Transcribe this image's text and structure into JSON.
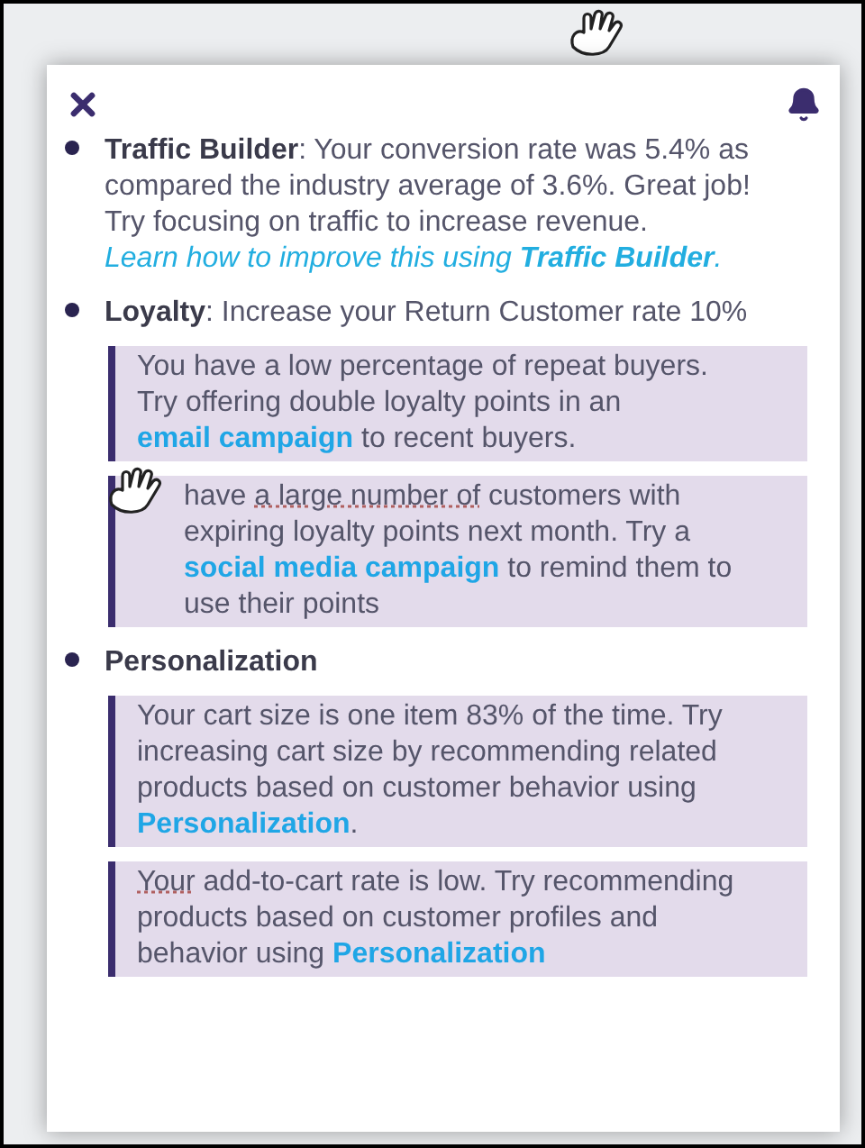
{
  "sections": [
    {
      "parts": [
        {
          "kind": "bold",
          "text": "Traffic Builder"
        },
        {
          "kind": "text",
          "text": ": Your conversion rate was 5.4% as compared the industry average of 3.6%.  Great job!  Try focusing on traffic to increase revenue.  "
        },
        {
          "kind": "emphasis",
          "text": "Learn how to improve"
        },
        {
          "kind": "emphasis",
          "text": "this using **Traffic Builder**."
        }
      ]
    },
    {
      "parts": [
        {
          "kind": "bold",
          "text": "Loyalty"
        },
        {
          "kind": "text",
          "text": ": Increase your Return Customer rate 10%"
        }
      ],
      "tips": [
        {
          "pointer": false,
          "parts": [
            {
              "kind": "text",
              "text": "You have a low percentage of repeat buyers. Try offering double loyalty points in an "
            },
            {
              "kind": "link",
              "text": "email campaign"
            },
            {
              "kind": "text",
              "text": " to recent buyers."
            }
          ]
        },
        {
          "pointer": true,
          "parts": [
            {
              "kind": "text",
              "text": "have "
            },
            {
              "kind": "flagged",
              "text": "a large number of"
            },
            {
              "kind": "text",
              "text": " customers with expiring loyalty points next month. Try a "
            },
            {
              "kind": "link",
              "text": "social media campaign"
            },
            {
              "kind": "text",
              "text": " to remind them to use their points"
            }
          ]
        }
      ]
    },
    {
      "parts": [
        {
          "kind": "bold",
          "text": "Personalization"
        }
      ],
      "tips": [
        {
          "pointer": false,
          "parts": [
            {
              "kind": "text",
              "text": "Your cart size is one item 83% of the time.  Try increasing cart size by recommending related products based on customer behavior using "
            },
            {
              "kind": "link",
              "text": "Personalization"
            },
            {
              "kind": "text",
              "text": "."
            }
          ]
        },
        {
          "pointer": false,
          "parts": [
            {
              "kind": "flagged",
              "text": "Your"
            },
            {
              "kind": "text",
              "text": " add-to-cart rate is low.  Try recommending products based on customer profiles and behavior using "
            },
            {
              "kind": "link",
              "text": "Personalization"
            }
          ]
        }
      ]
    }
  ]
}
